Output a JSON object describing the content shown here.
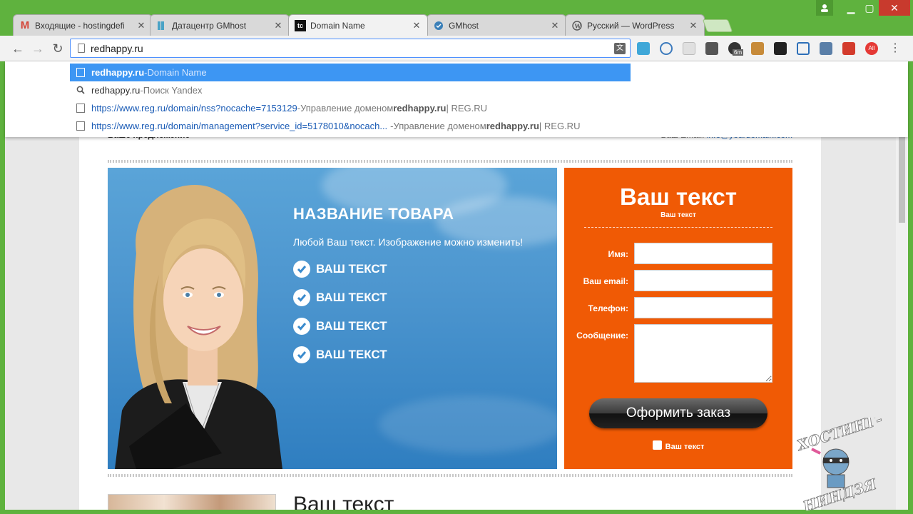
{
  "browser": {
    "tabs": [
      {
        "title": "Входящие - hostingdefi",
        "icon": "gmail-icon",
        "active": false
      },
      {
        "title": "Датацентр GMhost",
        "icon": "datacenter-icon",
        "active": false
      },
      {
        "title": "Domain Name",
        "icon": "tc-icon",
        "active": true
      },
      {
        "title": "GMhost",
        "icon": "gmhost-icon",
        "active": false
      },
      {
        "title": "Русский — WordPress",
        "icon": "wordpress-icon",
        "active": false
      }
    ],
    "address": "redhappy.ru",
    "suggestions": [
      {
        "url": "redhappy.ru",
        "sep": " - ",
        "desc": "Domain Name",
        "desc_bold": "",
        "desc_tail": "",
        "type": "page"
      },
      {
        "url": "redhappy.ru",
        "sep": " - ",
        "desc": "Поиск Yandex",
        "desc_bold": "",
        "desc_tail": "",
        "type": "search"
      },
      {
        "url": "https://www.reg.ru/domain/nss?nocache=7153129",
        "sep": " - ",
        "desc": "Управление доменом ",
        "desc_bold": "redhappy.ru",
        "desc_tail": " | REG.RU",
        "type": "page"
      },
      {
        "url": "https://www.reg.ru/domain/management?service_id=5178010&nocach...",
        "sep": " - ",
        "desc": "Управление доменом ",
        "desc_bold": "redhappy.ru",
        "desc_tail": " | REG.RU",
        "type": "page"
      }
    ],
    "extension_badge": "6m",
    "extension_abp": "All"
  },
  "page": {
    "header_left": "Ваше предложение",
    "header_right_label": "Ваш Email: ",
    "header_right_link": "info@yourdomain.com",
    "hero": {
      "title": "НАЗВАНИЕ ТОВАРА",
      "subtitle": "Любой Ваш текст. Изображение можно изменить!",
      "items": [
        "ВАШ ТЕКСТ",
        "ВАШ ТЕКСТ",
        "ВАШ ТЕКСТ",
        "ВАШ ТЕКСТ"
      ]
    },
    "form": {
      "title": "Ваш текст",
      "subtitle": "Ваш текст",
      "name_label": "Имя:",
      "email_label": "Ваш email:",
      "phone_label": "Телефон:",
      "message_label": "Сообщение:",
      "submit_label": "Оформить заказ",
      "secure_text": "Ваш текст"
    },
    "bottom_title": "Ваш текст"
  },
  "watermark": {
    "top": "ХОСТИНГ-",
    "bottom": "НИНДЗЯ"
  },
  "colors": {
    "frame": "#5fb23e",
    "form_bg": "#f05a05",
    "hero_bg": "#4d96cf",
    "selection": "#3d96f3"
  }
}
